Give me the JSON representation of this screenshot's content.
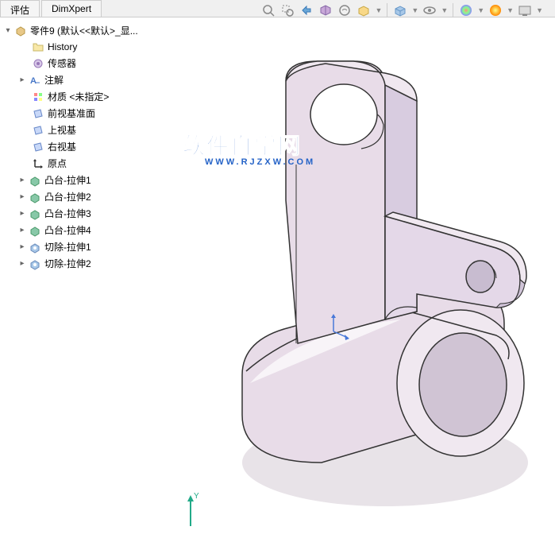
{
  "tabs": {
    "evaluate": "评估",
    "dimxpert": "DimXpert"
  },
  "tree": {
    "root": "零件9 (默认<<默认>_显...",
    "items": [
      {
        "label": "History",
        "icon": "folder"
      },
      {
        "label": "传感器",
        "icon": "sensor"
      },
      {
        "label": "注解",
        "icon": "annotation",
        "expandable": true
      },
      {
        "label": "材质 <未指定>",
        "icon": "material"
      },
      {
        "label": "前视基准面",
        "icon": "plane"
      },
      {
        "label": "上视基",
        "icon": "plane"
      },
      {
        "label": "右视基",
        "icon": "plane"
      },
      {
        "label": "原点",
        "icon": "origin"
      },
      {
        "label": "凸台-拉伸1",
        "icon": "extrude",
        "expandable": true
      },
      {
        "label": "凸台-拉伸2",
        "icon": "extrude",
        "expandable": true
      },
      {
        "label": "凸台-拉伸3",
        "icon": "extrude",
        "expandable": true
      },
      {
        "label": "凸台-拉伸4",
        "icon": "extrude",
        "expandable": true
      },
      {
        "label": "切除-拉伸1",
        "icon": "cut",
        "expandable": true
      },
      {
        "label": "切除-拉伸2",
        "icon": "cut",
        "expandable": true
      }
    ]
  },
  "watermark": {
    "main": "软件自学网",
    "sub": "WWW.RJZXW.COM"
  },
  "triad": {
    "y_label": "Y"
  }
}
